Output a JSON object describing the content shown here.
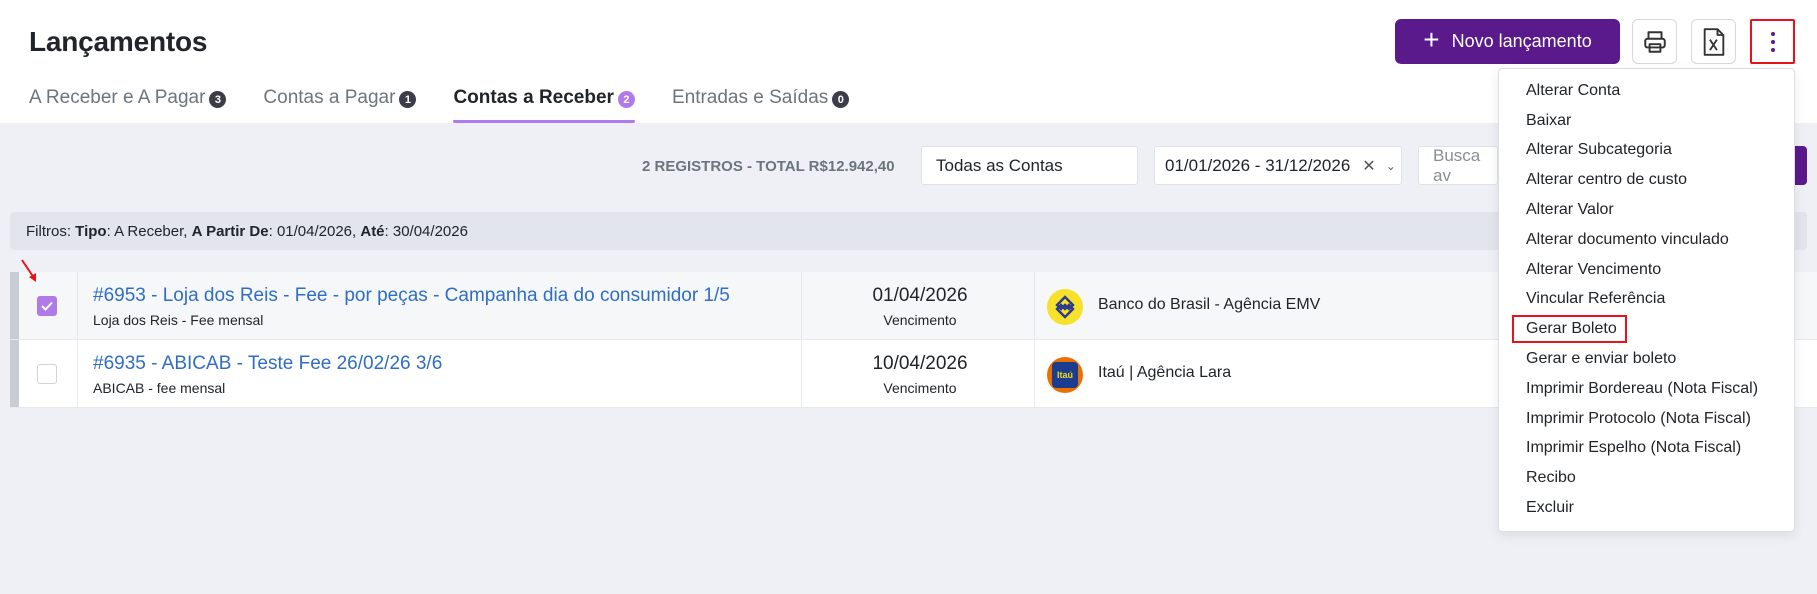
{
  "header": {
    "title": "Lançamentos",
    "new_button_label": "Novo lançamento"
  },
  "tabs": [
    {
      "label": "A Receber e A Pagar",
      "count": "3"
    },
    {
      "label": "Contas a Pagar",
      "count": "1"
    },
    {
      "label": "Contas a Receber",
      "count": "2",
      "active": true
    },
    {
      "label": "Entradas e Saídas",
      "count": "0"
    }
  ],
  "toolbar": {
    "summary": "2 REGISTROS - TOTAL R$12.942,40",
    "account_select": "Todas as Contas",
    "date_range": "01/01/2026 - 31/12/2026",
    "search_placeholder": "Busca av"
  },
  "filters": {
    "prefix": "Filtros:",
    "tipo_label": "Tipo",
    "tipo_value": ": A Receber,",
    "from_label": "A Partir De",
    "from_value": ": 01/04/2026,",
    "to_label": "Até",
    "to_value": ": 30/04/2026"
  },
  "rows": [
    {
      "title": "#6953 - Loja dos Reis - Fee - por peças - Campanha dia do consumidor 1/5",
      "subtitle": "Loja dos Reis - Fee mensal",
      "date": "01/04/2026",
      "date_label": "Vencimento",
      "bank": "Banco do Brasil - Agência EMV",
      "checked": true
    },
    {
      "title": "#6935 - ABICAB - Teste Fee 26/02/26 3/6",
      "subtitle": "ABICAB - fee mensal",
      "date": "10/04/2026",
      "date_label": "Vencimento",
      "bank": "Itaú | Agência Lara",
      "bank_logo_text": "Itaú",
      "checked": false
    }
  ],
  "menu": {
    "items": [
      "Alterar Conta",
      "Baixar",
      "Alterar Subcategoria",
      "Alterar centro de custo",
      "Alterar Valor",
      "Alterar documento vinculado",
      "Alterar Vencimento",
      "Vincular Referência",
      "Gerar Boleto",
      "Gerar e enviar boleto",
      "Imprimir Bordereau (Nota Fiscal)",
      "Imprimir Protocolo (Nota Fiscal)",
      "Imprimir Espelho (Nota Fiscal)",
      "Recibo",
      "Excluir"
    ],
    "highlighted_index": 8
  },
  "colors": {
    "primary": "#5a1a8c",
    "accent": "#b07be8",
    "link": "#2f6ec4",
    "annotation": "#e8121a"
  }
}
